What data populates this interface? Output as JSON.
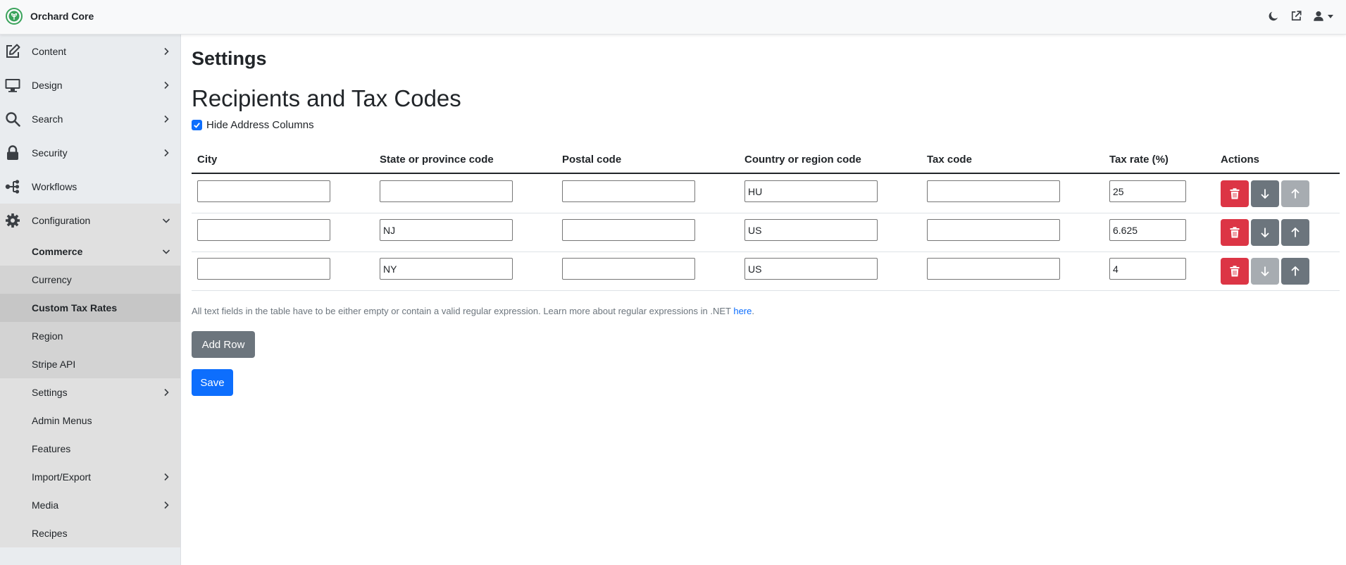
{
  "app": {
    "title": "Orchard Core",
    "logo": "orchard-core-logo",
    "accent": "#3aa35b"
  },
  "topbar": {
    "icons": [
      "moon-icon",
      "external-link-icon",
      "user-icon"
    ]
  },
  "sidebar": {
    "items": [
      {
        "label": "Content",
        "icon": "edit-icon"
      },
      {
        "label": "Design",
        "icon": "monitor-icon"
      },
      {
        "label": "Search",
        "icon": "search-icon"
      },
      {
        "label": "Security",
        "icon": "lock-icon"
      },
      {
        "label": "Workflows",
        "icon": "workflow-icon"
      },
      {
        "label": "Configuration",
        "icon": "gear-icon"
      }
    ],
    "configuration_children": [
      {
        "label": "Commerce"
      },
      {
        "label": "Settings"
      },
      {
        "label": "Admin Menus"
      },
      {
        "label": "Features"
      },
      {
        "label": "Import/Export"
      },
      {
        "label": "Media"
      },
      {
        "label": "Recipes"
      }
    ],
    "commerce_children": [
      {
        "label": "Currency"
      },
      {
        "label": "Custom Tax Rates",
        "active": true
      },
      {
        "label": "Region"
      },
      {
        "label": "Stripe API"
      }
    ]
  },
  "main": {
    "page_title": "Settings",
    "section_title": "Recipients and Tax Codes",
    "hide_address": {
      "label": "Hide Address Columns",
      "checked": true
    },
    "table": {
      "headers": [
        "City",
        "State or province code",
        "Postal code",
        "Country or region code",
        "Tax code",
        "Tax rate (%)",
        "Actions"
      ],
      "rows": [
        {
          "city": "",
          "state": "",
          "postal": "",
          "country": "HU",
          "tax_code": "",
          "rate": "25",
          "down_enabled": true,
          "up_enabled": false
        },
        {
          "city": "",
          "state": "NJ",
          "postal": "",
          "country": "US",
          "tax_code": "",
          "rate": "6.625",
          "down_enabled": true,
          "up_enabled": true
        },
        {
          "city": "",
          "state": "NY",
          "postal": "",
          "country": "US",
          "tax_code": "",
          "rate": "4",
          "down_enabled": false,
          "up_enabled": true
        }
      ]
    },
    "help_text": "All text fields in the table have to be either empty or contain a valid regular expression. Learn more about regular expressions in .NET ",
    "help_link": "here",
    "help_end": ".",
    "add_row_label": "Add Row",
    "save_label": "Save"
  },
  "colors": {
    "danger": "#dc3545",
    "secondary": "#6c757d",
    "primary": "#0d6efd"
  }
}
